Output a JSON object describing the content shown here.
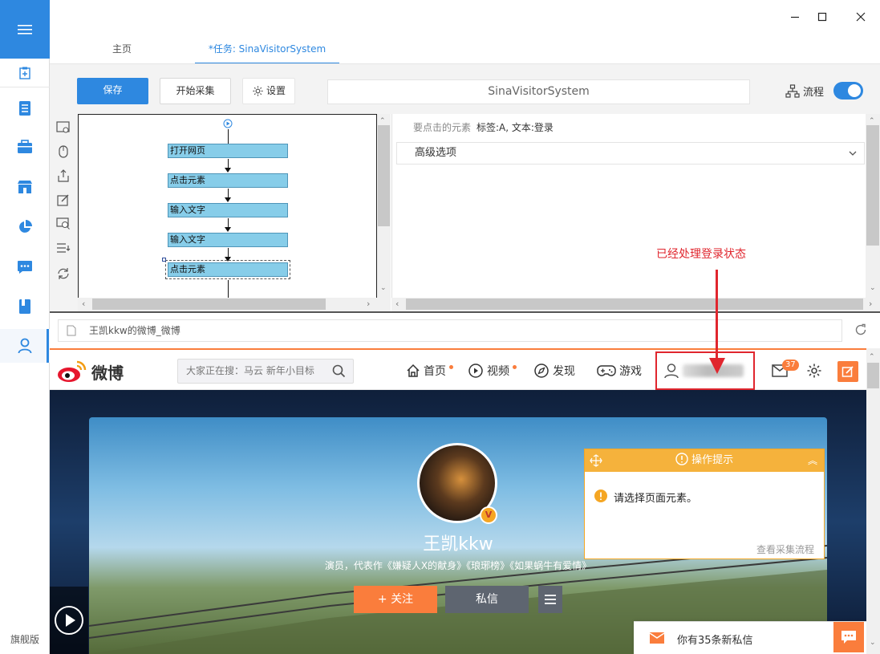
{
  "sidebar": {
    "edition": "旗舰版",
    "active_item": "user"
  },
  "tabs": [
    {
      "label": "主页"
    },
    {
      "label": "*任务: SinaVisitorSystem"
    }
  ],
  "toolbar": {
    "save_label": "保存",
    "start_label": "开始采集",
    "settings_label": "设置",
    "task_name": "SinaVisitorSystem",
    "flow_label": "流程",
    "flow_enabled": true
  },
  "flow": {
    "nodes": [
      {
        "label": "打开网页"
      },
      {
        "label": "点击元素"
      },
      {
        "label": "输入文字"
      },
      {
        "label": "输入文字"
      },
      {
        "label": "点击元素"
      }
    ]
  },
  "props": {
    "target_label": "要点击的元素",
    "target_value": "标签:A, 文本:登录",
    "advanced_label": "高级选项"
  },
  "browser": {
    "url": "王凯kkw的微博_微博"
  },
  "weibo": {
    "logo_text": "微博",
    "search_placeholder": "大家正在搜：马云 新年小目标",
    "nav": {
      "home": "首页",
      "video": "视频",
      "discover": "发现",
      "games": "游戏"
    },
    "mail_count": "37",
    "profile_name": "王凯kkw",
    "profile_desc": "演员，代表作《嫌疑人X的献身》《琅琊榜》《如果蜗牛有爱情》",
    "follow_label": "+ 关注",
    "message_label": "私信",
    "vbadge": "V",
    "message_bar": "你有35条新私信"
  },
  "tip_panel": {
    "title": "操作提示",
    "message": "请选择页面元素。",
    "link": "查看采集流程"
  },
  "annotation": {
    "text": "已经处理登录状态"
  },
  "colors": {
    "accent": "#2e88e0",
    "weibo_orange": "#fa7d3c",
    "annotation_red": "#e0262e",
    "flow_node": "#87cde9"
  }
}
